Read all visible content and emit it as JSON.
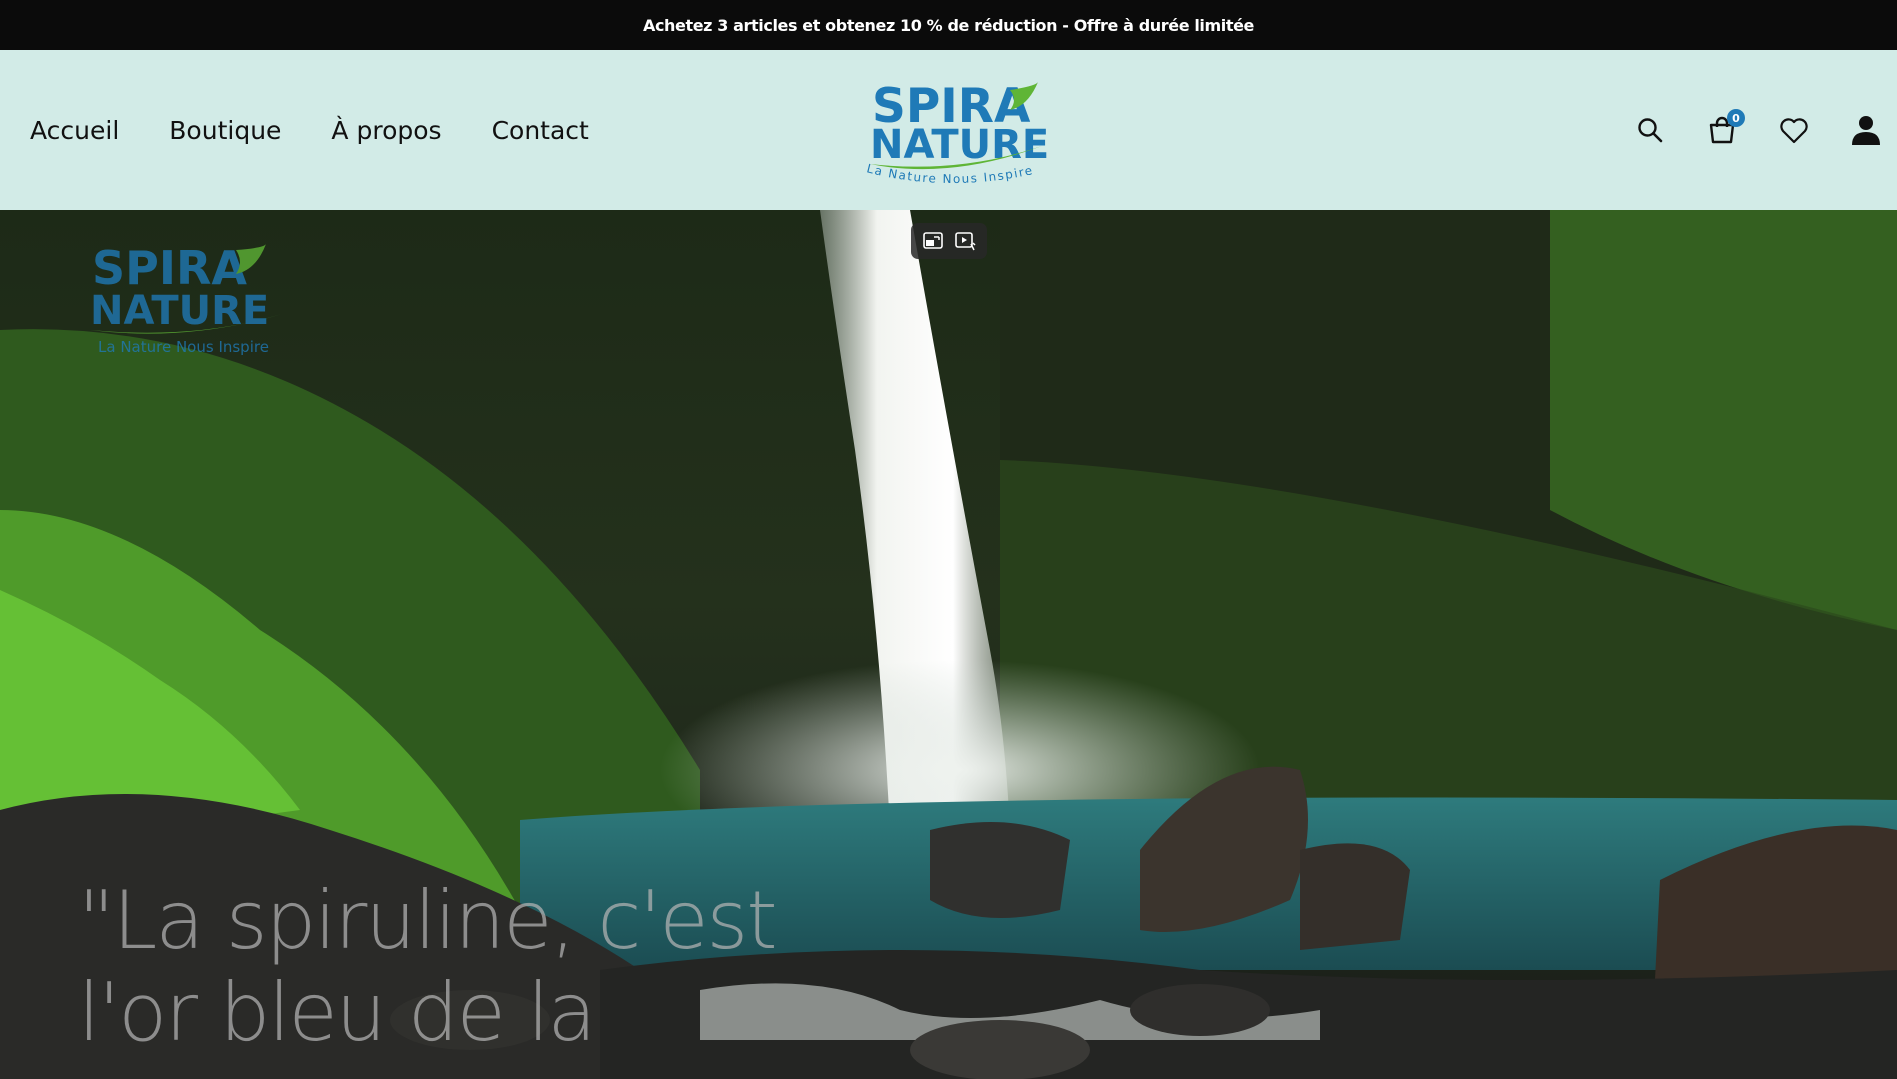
{
  "announcement": {
    "text": "Achetez 3 articles et obtenez 10 % de réduction - Offre à durée limitée"
  },
  "nav": {
    "items": [
      {
        "label": "Accueil"
      },
      {
        "label": "Boutique"
      },
      {
        "label": "À propos"
      },
      {
        "label": "Contact"
      }
    ]
  },
  "brand": {
    "line1": "SPIRA",
    "line2": "NATURE",
    "tagline": "La Nature Nous Inspire",
    "color_primary": "#1f7ab7",
    "color_leaf": "#5fb536"
  },
  "header_icons": {
    "search": "search-icon",
    "cart": "cart-icon",
    "cart_count": "0",
    "wishlist": "heart-icon",
    "account": "user-icon"
  },
  "hero": {
    "quote": "\"La spiruline, c'est l'or bleu de la",
    "video_controls": [
      "exit-fullscreen-icon",
      "picture-in-picture-icon"
    ]
  },
  "colors": {
    "announcement_bg": "#0b0b0b",
    "header_bg": "#d2ebe7",
    "badge_bg": "#1f7ab7"
  }
}
